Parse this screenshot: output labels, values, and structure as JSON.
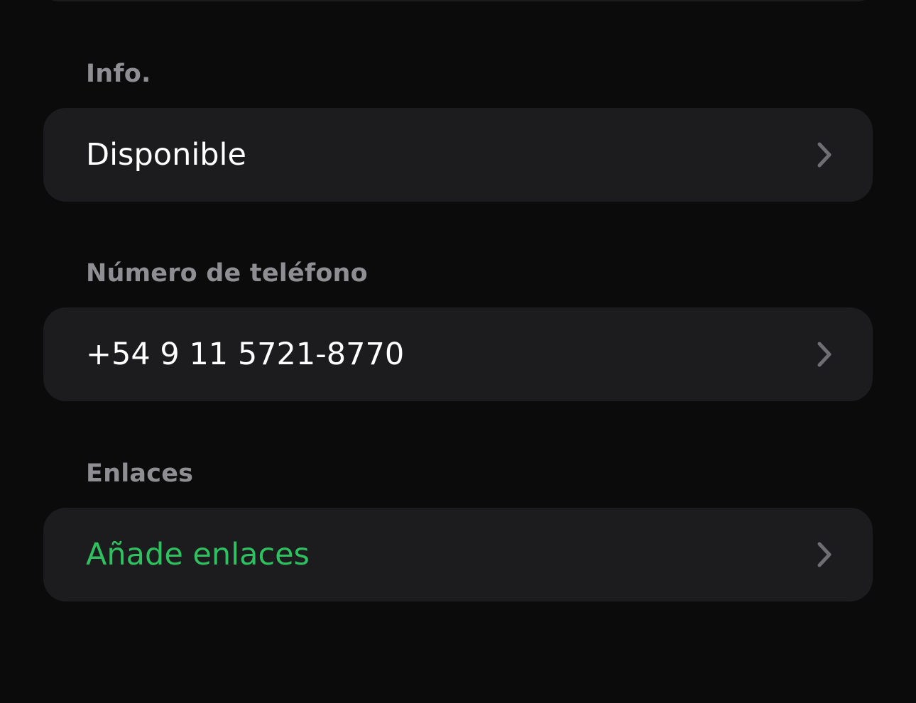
{
  "sections": [
    {
      "header": "Info.",
      "row": {
        "label": "Disponible",
        "icon": "chevron-right-icon"
      }
    },
    {
      "header": "Número de teléfono",
      "row": {
        "label": "+54 9 11 5721-8770",
        "icon": "chevron-right-icon"
      }
    },
    {
      "header": "Enlaces",
      "row": {
        "label": "Añade enlaces",
        "icon": "chevron-right-icon",
        "color": "#2fc05f"
      }
    }
  ],
  "colors": {
    "background": "#0b0b0c",
    "card": "#1c1c1e",
    "header_text": "#8e8e93",
    "primary_text": "#ffffff",
    "accent": "#2fc05f",
    "chevron": "#6e6e73"
  }
}
